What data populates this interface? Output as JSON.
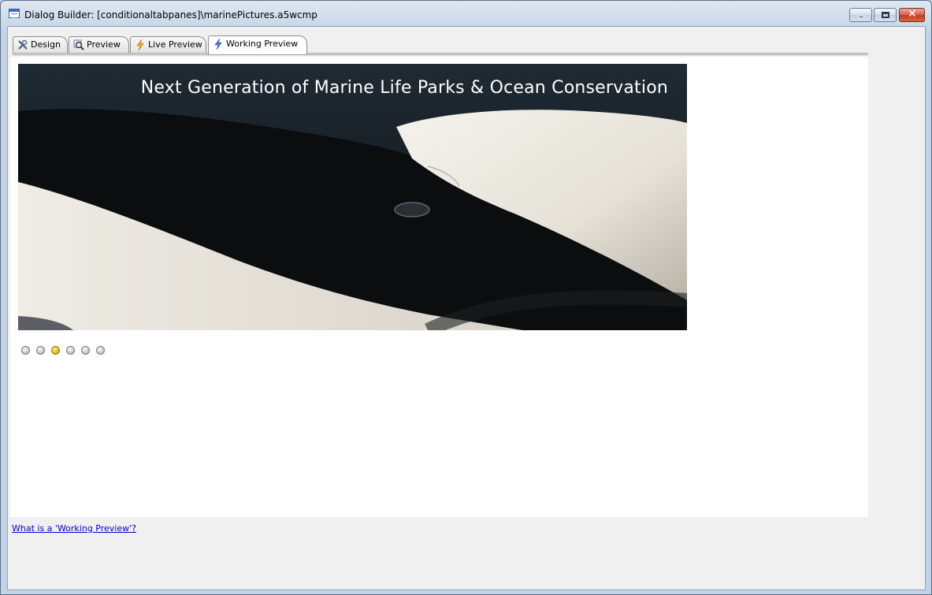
{
  "window": {
    "title": "Dialog Builder: [conditionaltabpanes]\\marinePictures.a5wcmp"
  },
  "tabs": [
    {
      "label": "Design",
      "icon": "tools-icon"
    },
    {
      "label": "Preview",
      "icon": "magnifier-icon"
    },
    {
      "label": "Live Preview",
      "icon": "lightning-icon"
    },
    {
      "label": "Working Preview",
      "icon": "lightning-blue-icon",
      "active": true
    }
  ],
  "slideshow": {
    "caption": "Next Generation of Marine Life Parks & Ocean Conservation",
    "total_slides": 6,
    "active_slide_index": 2
  },
  "footer": {
    "help_link": "What is a 'Working Preview'?"
  },
  "colors": {
    "accent_active_dot": "#e8bb1e",
    "link": "#0000cc"
  }
}
